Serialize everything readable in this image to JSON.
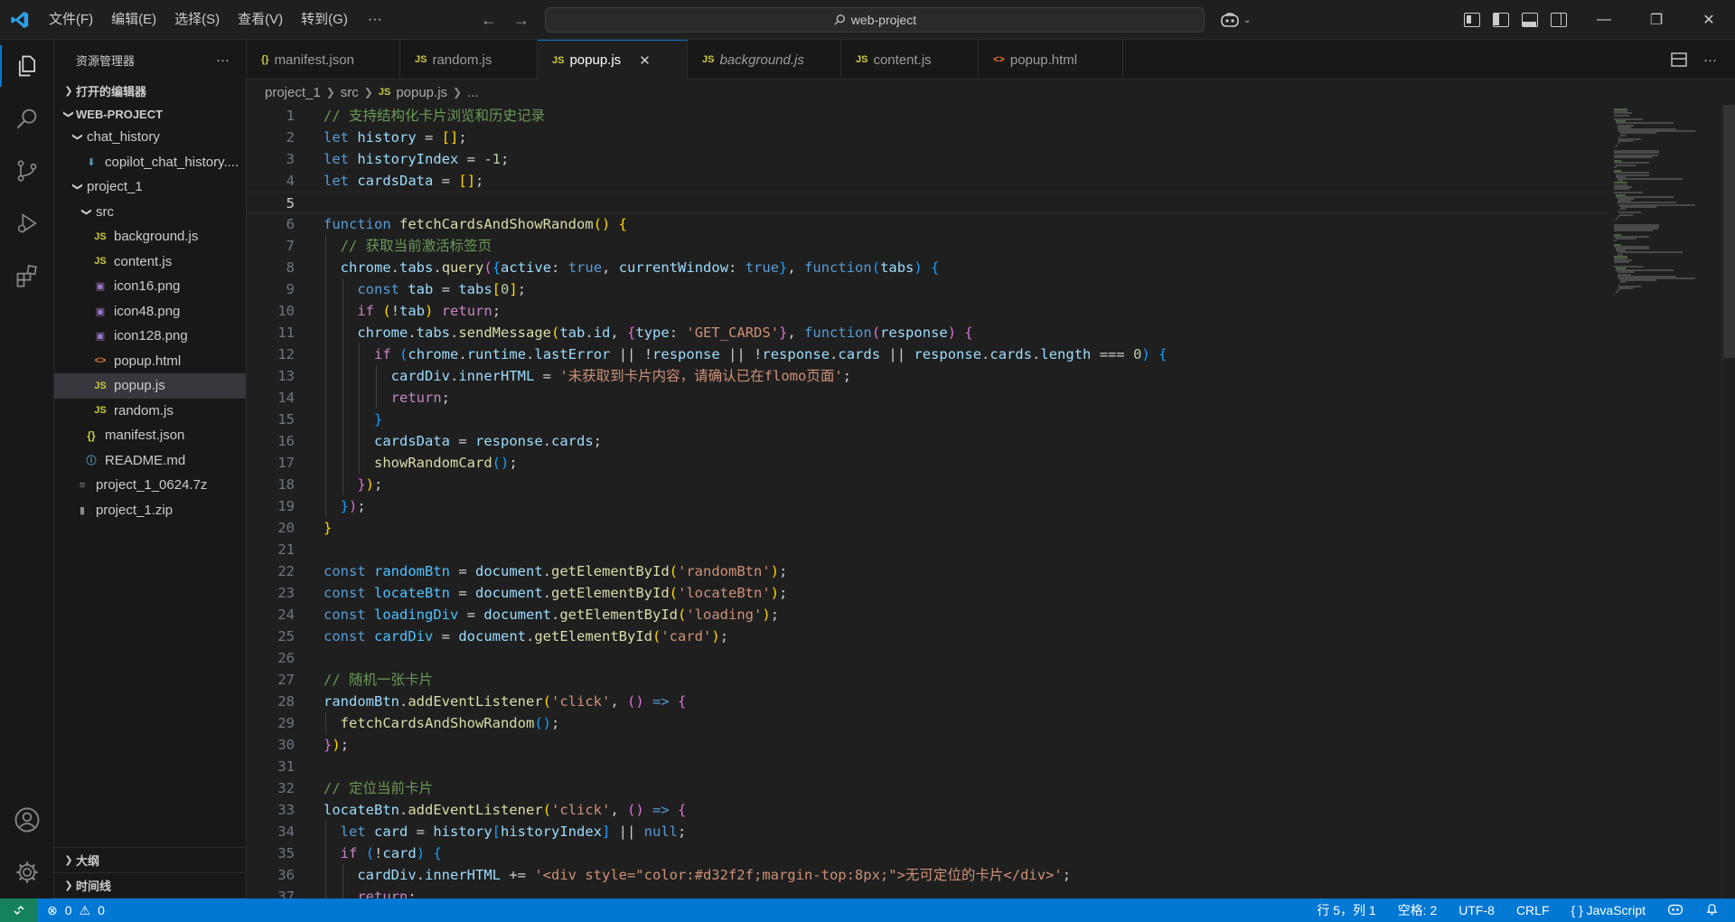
{
  "menubar": {
    "items": [
      "文件(F)",
      "编辑(E)",
      "选择(S)",
      "查看(V)",
      "转到(G)"
    ],
    "more": "···"
  },
  "command_center": {
    "label": "web-project"
  },
  "sidebar": {
    "title": "资源管理器",
    "more": "···",
    "open_editors": "打开的编辑器",
    "project": "WEB-PROJECT",
    "tree": [
      {
        "label": "chat_history",
        "type": "folder",
        "depth": 1
      },
      {
        "label": "copilot_chat_history....",
        "type": "chat",
        "depth": 2
      },
      {
        "label": "project_1",
        "type": "folder",
        "depth": 1
      },
      {
        "label": "src",
        "type": "folder",
        "depth": 2
      },
      {
        "label": "background.js",
        "type": "js",
        "depth": 3
      },
      {
        "label": "content.js",
        "type": "js",
        "depth": 3
      },
      {
        "label": "icon16.png",
        "type": "png",
        "depth": 3
      },
      {
        "label": "icon48.png",
        "type": "png",
        "depth": 3
      },
      {
        "label": "icon128.png",
        "type": "png",
        "depth": 3
      },
      {
        "label": "popup.html",
        "type": "html",
        "depth": 3
      },
      {
        "label": "popup.js",
        "type": "js",
        "depth": 3,
        "selected": true
      },
      {
        "label": "random.js",
        "type": "js",
        "depth": 3
      },
      {
        "label": "manifest.json",
        "type": "json",
        "depth": 2
      },
      {
        "label": "README.md",
        "type": "md",
        "depth": 2
      },
      {
        "label": "project_1_0624.7z",
        "type": "archive",
        "depth": 1
      },
      {
        "label": "project_1.zip",
        "type": "zip",
        "depth": 1
      }
    ],
    "outline": "大纲",
    "timeline": "时间线"
  },
  "tabs": [
    {
      "label": "manifest.json",
      "icon": "{}",
      "type": "json"
    },
    {
      "label": "random.js",
      "icon": "JS",
      "type": "js"
    },
    {
      "label": "popup.js",
      "icon": "JS",
      "type": "js",
      "active": true
    },
    {
      "label": "background.js",
      "icon": "JS",
      "type": "js",
      "italic": true
    },
    {
      "label": "content.js",
      "icon": "JS",
      "type": "js"
    },
    {
      "label": "popup.html",
      "icon": "<>",
      "type": "html"
    }
  ],
  "breadcrumb": {
    "parts": [
      "project_1",
      "src",
      "popup.js",
      "..."
    ]
  },
  "editor": {
    "current_line": 5,
    "lines": [
      "// 支持结构化卡片浏览和历史记录",
      "let history = [];",
      "let historyIndex = -1;",
      "let cardsData = [];",
      "",
      "function fetchCardsAndShowRandom() {",
      "  // 获取当前激活标签页",
      "  chrome.tabs.query({active: true, currentWindow: true}, function(tabs) {",
      "    const tab = tabs[0];",
      "    if (!tab) return;",
      "    chrome.tabs.sendMessage(tab.id, {type: 'GET_CARDS'}, function(response) {",
      "      if (chrome.runtime.lastError || !response || !response.cards || response.cards.length === 0) {",
      "        cardDiv.innerHTML = '未获取到卡片内容，请确认已在flomo页面';",
      "        return;",
      "      }",
      "      cardsData = response.cards;",
      "      showRandomCard();",
      "    });",
      "  });",
      "}",
      "",
      "const randomBtn = document.getElementById('randomBtn');",
      "const locateBtn = document.getElementById('locateBtn');",
      "const loadingDiv = document.getElementById('loading');",
      "const cardDiv = document.getElementById('card');",
      "",
      "// 随机一张卡片",
      "randomBtn.addEventListener('click', () => {",
      "  fetchCardsAndShowRandom();",
      "});",
      "",
      "// 定位当前卡片",
      "locateBtn.addEventListener('click', () => {",
      "  let card = history[historyIndex] || null;",
      "  if (!card) {",
      "    cardDiv.innerHTML += '<div style=\"color:#d32f2f;margin-top:8px;\">无可定位的卡片</div>';",
      "    return;"
    ]
  },
  "statusbar": {
    "errors": "0",
    "warnings": "0",
    "position": "行 5，列 1",
    "spaces": "空格: 2",
    "encoding": "UTF-8",
    "eol": "CRLF",
    "language": "JavaScript"
  },
  "colors": {
    "accent": "#0078d4",
    "remote": "#16825d",
    "background": "#1f1f1f",
    "sidebar": "#181818"
  }
}
